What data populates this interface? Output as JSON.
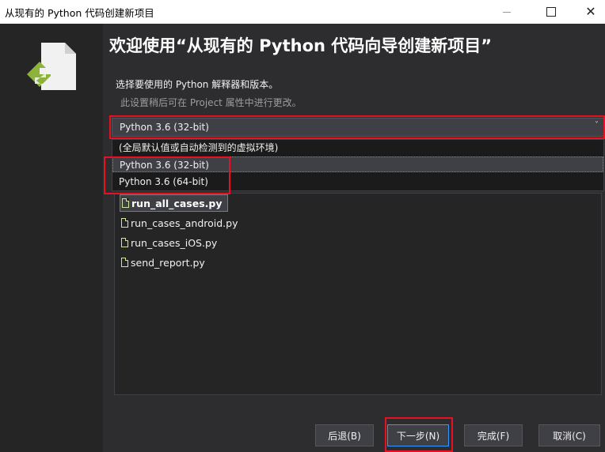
{
  "window": {
    "title": "从现有的 Python 代码创建新项目",
    "close_glyph": "✕"
  },
  "wizard": {
    "heading": "欢迎使用“从现有的 Python 代码向导创建新项目”",
    "prompt": "选择要使用的 Python 解释器和版本。",
    "hint": "此设置稍后可在 Project 属性中进行更改。"
  },
  "interpreter": {
    "selected": "Python 3.6 (32-bit)",
    "chevron": "˅",
    "options": [
      "(全局默认值或自动检测到的虚拟环境)",
      "Python 3.6 (32-bit)",
      "Python 3.6 (64-bit)"
    ]
  },
  "files": [
    "run_all_cases.py",
    "run_cases_android.py",
    "run_cases_iOS.py",
    "send_report.py"
  ],
  "buttons": {
    "back": "后退(B)",
    "next": "下一步(N)",
    "finish": "完成(F)",
    "cancel": "取消(C)"
  },
  "colors": {
    "background": "#2d2d30",
    "rail": "#252526",
    "highlight": "#e81123",
    "accent": "#3399ff",
    "logo_green": "#8db33a"
  }
}
